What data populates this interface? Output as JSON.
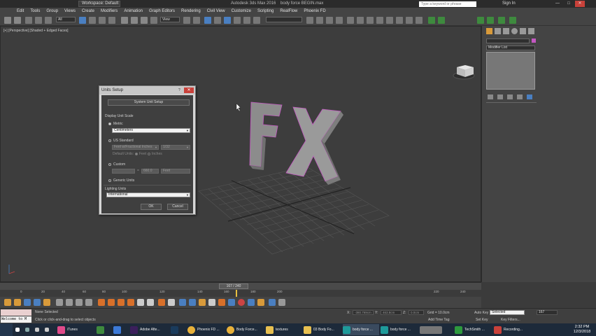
{
  "titlebar": {
    "workspace": "Workspace: Default",
    "title": "Autodesk 3ds Max 2016    body force BEGIN.max",
    "search_placeholder": "Type a keyword or phrase",
    "signin": "Sign In"
  },
  "menu": [
    "Edit",
    "Tools",
    "Group",
    "Views",
    "Create",
    "Modifiers",
    "Animation",
    "Graph Editors",
    "Rendering",
    "Civil View",
    "Customize",
    "Scripting",
    "RealFlow",
    "Phoenix FD"
  ],
  "toolbar": {
    "filter_dropdown": "All",
    "refcoord_dropdown": "View"
  },
  "viewport": {
    "label": "[+] [Perspective] [Shaded + Edged Faces]",
    "fx_text": "FX"
  },
  "command_panel": {
    "modifier_list": "Modifier List",
    "object_color": "#c458c2"
  },
  "dialog": {
    "title": "Units Setup",
    "system_unit_button": "System Unit Setup",
    "display_group_label": "Display Unit Scale",
    "metric_label": "Metric",
    "metric_value": "Centimeters",
    "us_label": "US Standard",
    "us_value": "Feet w/Fractional Inches",
    "us_fraction": "1/32",
    "default_units_label": "Default Units:",
    "feet_label": "Feet",
    "inches_label": "Inches",
    "custom_label": "Custom",
    "custom_eq": "=",
    "custom_value": "660.0",
    "custom_unit": "Feet",
    "generic_label": "Generic Units",
    "lighting_group_label": "Lighting Units",
    "lighting_value": "International",
    "ok": "OK",
    "cancel": "Cancel"
  },
  "timeline": {
    "slider_label": "167 / 240",
    "ticks": [
      "0",
      "20",
      "40",
      "60",
      "80",
      "100",
      "120",
      "140",
      "160",
      "180",
      "200",
      "220",
      "240"
    ]
  },
  "status": {
    "maxscript_top": "",
    "maxscript_bottom": "Welcome to M",
    "line1": "None Selected",
    "line2": "Click or click-and-drag to select objects",
    "x_label": "X:",
    "x_value": "-380.769cm",
    "y_label": "Y:",
    "y_value": "463.8cm",
    "z_label": "Z:",
    "z_value": "0.0cm",
    "grid": "Grid = 10.0cm",
    "add_time_tag": "Add Time Tag",
    "auto_key": "Auto Key",
    "selected": "Selected",
    "set_key": "Set Key",
    "key_filters": "Key Filters...",
    "frame": "167"
  },
  "taskbar": {
    "items": [
      {
        "label": "iTunes"
      },
      {
        "label": ""
      },
      {
        "label": ""
      },
      {
        "label": "Adobe Afte..."
      },
      {
        "label": ""
      },
      {
        "label": "Phoenix FD ..."
      },
      {
        "label": "Body Force..."
      },
      {
        "label": "textures"
      },
      {
        "label": "03 Body Fo..."
      },
      {
        "label": "body force ..."
      },
      {
        "label": "body force ..."
      },
      {
        "label": "TechSmith ..."
      },
      {
        "label": "Recording..."
      }
    ],
    "time": "2:32 PM",
    "date": "12/3/2018"
  }
}
